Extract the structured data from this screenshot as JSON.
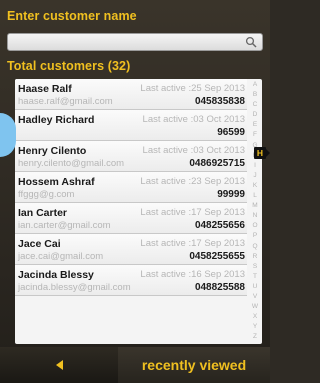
{
  "search": {
    "label": "Enter customer name",
    "value": "",
    "placeholder": ""
  },
  "list_header": "Total customers (32)",
  "customers": [
    {
      "name": "Haase Ralf",
      "last_active": "Last active :25 Sep 2013",
      "email": "haase.ralf@gmail.com",
      "phone": "045835838"
    },
    {
      "name": "Hadley Richard",
      "last_active": "Last active :03 Oct 2013",
      "email": "",
      "phone": "96599"
    },
    {
      "name": "Henry Cilento",
      "last_active": "Last active :03 Oct 2013",
      "email": "henry.cilento@gmail.com",
      "phone": "0486925715"
    },
    {
      "name": "Hossem Ashraf",
      "last_active": "Last active :23 Sep 2013",
      "email": "ffggg@g.com",
      "phone": "99999"
    },
    {
      "name": "Ian Carter",
      "last_active": "Last active :17 Sep 2013",
      "email": "ian.carter@gmail.com",
      "phone": "048255656"
    },
    {
      "name": "Jace Cai",
      "last_active": "Last active :17 Sep 2013",
      "email": "jace.cai@gmail.com",
      "phone": "0458255655"
    },
    {
      "name": "Jacinda Blessy",
      "last_active": "Last active :16 Sep 2013",
      "email": "jacinda.blessy@gmail.com",
      "phone": "048825588"
    }
  ],
  "index": {
    "letters": [
      "A",
      "B",
      "C",
      "D",
      "E",
      "F",
      "G",
      "H",
      "I",
      "J",
      "K",
      "L",
      "M",
      "N",
      "O",
      "P",
      "Q",
      "R",
      "S",
      "T",
      "U",
      "V",
      "W",
      "X",
      "Y",
      "Z"
    ],
    "active_letter": "H"
  },
  "bottom": {
    "back_icon": "left-arrow-icon",
    "recent_label": "recently viewed"
  },
  "colors": {
    "accent": "#f0c020",
    "slide_panel": "#7fc4ef",
    "background": "#2e2a24"
  }
}
